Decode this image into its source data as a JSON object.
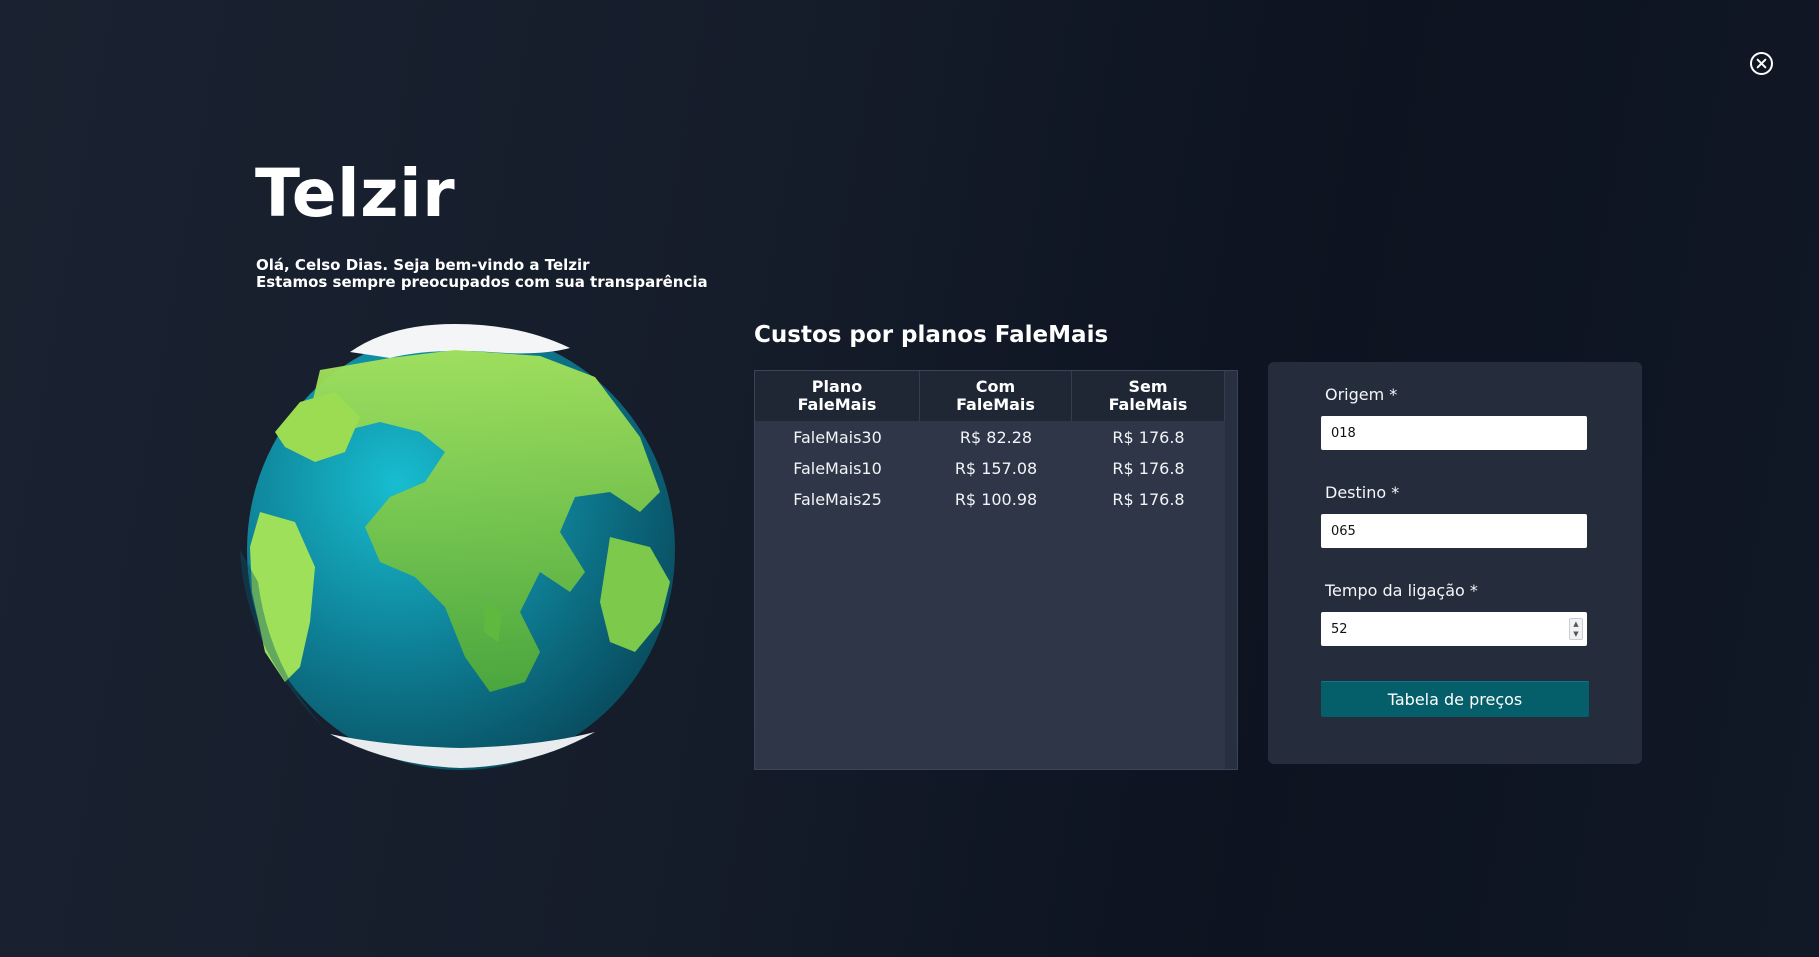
{
  "app": {
    "brand": "Telzir",
    "greeting_line1": "Olá, Celso Dias. Seja bem-vindo a Telzir",
    "greeting_line2": "Estamos sempre preocupados com sua transparência"
  },
  "icons": {
    "close": "close-circle-icon",
    "globe": "globe-illustration"
  },
  "costs": {
    "title": "Custos por planos FaleMais",
    "headers": {
      "plan_line1": "Plano",
      "plan_line2": "FaleMais",
      "with_line1": "Com",
      "with_line2": "FaleMais",
      "without_line1": "Sem",
      "without_line2": "FaleMais"
    },
    "rows": [
      {
        "plan": "FaleMais30",
        "with": "R$ 82.28",
        "without": "R$ 176.8"
      },
      {
        "plan": "FaleMais10",
        "with": "R$ 157.08",
        "without": "R$ 176.8"
      },
      {
        "plan": "FaleMais25",
        "with": "R$ 100.98",
        "without": "R$ 176.8"
      }
    ]
  },
  "form": {
    "origin_label": "Origem *",
    "origin_value": "018",
    "destination_label": "Destino *",
    "destination_value": "065",
    "duration_label": "Tempo da ligação *",
    "duration_value": "52",
    "submit_label": "Tabela de preços"
  },
  "colors": {
    "background": "#151c2a",
    "panel": "#252d3d",
    "table": "#2e3647",
    "button": "#055f6b"
  }
}
